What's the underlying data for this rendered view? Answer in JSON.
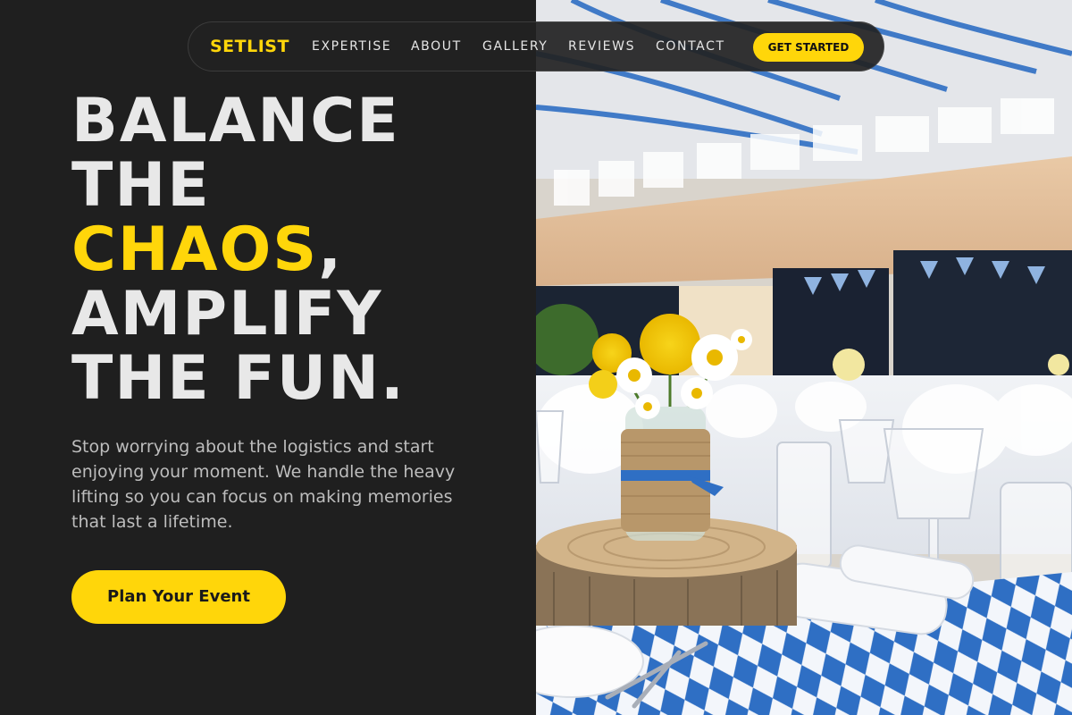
{
  "nav": {
    "brand": "SETLIST",
    "links": [
      "EXPERTISE",
      "ABOUT",
      "GALLERY",
      "REVIEWS",
      "CONTACT"
    ],
    "cta": "GET STARTED"
  },
  "hero": {
    "headline": {
      "line1": "BALANCE",
      "line2": "THE",
      "accent": "CHAOS",
      "comma": ",",
      "line4": "AMPLIFY",
      "line5": "THE FUN."
    },
    "description": "Stop worrying about the logistics and start enjoying your moment. We handle the heavy lifting so you can focus on making memories that last a lifetime.",
    "cta": "Plan Your Event"
  },
  "colors": {
    "accent": "#ffd60a",
    "background": "#1f1f1f",
    "text": "#e8e8e8"
  }
}
